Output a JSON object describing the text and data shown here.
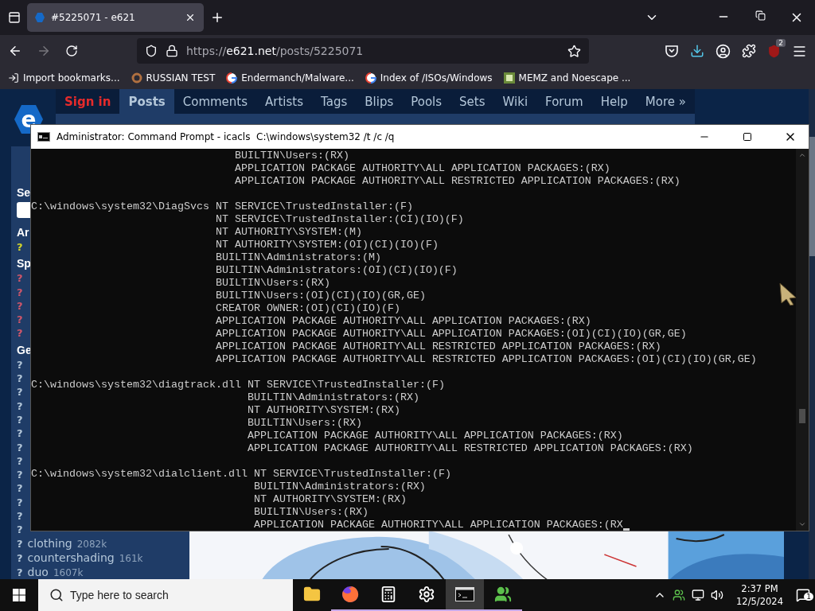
{
  "browser": {
    "tabs": [
      {
        "title": "#5225071 - e621",
        "selected": true
      }
    ],
    "url": {
      "scheme": "https://",
      "domain": "e621.net",
      "path": "/posts/5225071"
    },
    "extension_badge": "2",
    "bookmarks": [
      {
        "label": "Import bookmarks...",
        "kind": "import"
      },
      {
        "label": "RUSSIAN TEST",
        "kind": "avatar"
      },
      {
        "label": "Endermanch/Malware...",
        "kind": "google"
      },
      {
        "label": "Index of /ISOs/Windows",
        "kind": "google"
      },
      {
        "label": "MEMZ and Noescape ...",
        "kind": "site"
      }
    ]
  },
  "site": {
    "logo_text": "e",
    "nav": [
      {
        "label": "Sign in",
        "kind": "signin",
        "selected": false
      },
      {
        "label": "Posts",
        "kind": "link",
        "selected": true
      },
      {
        "label": "Comments",
        "kind": "link",
        "selected": false
      },
      {
        "label": "Artists",
        "kind": "link",
        "selected": false
      },
      {
        "label": "Tags",
        "kind": "link",
        "selected": false
      },
      {
        "label": "Blips",
        "kind": "link",
        "selected": false
      },
      {
        "label": "Pools",
        "kind": "link",
        "selected": false
      },
      {
        "label": "Sets",
        "kind": "link",
        "selected": false
      },
      {
        "label": "Wiki",
        "kind": "link",
        "selected": false
      },
      {
        "label": "Forum",
        "kind": "link",
        "selected": false
      },
      {
        "label": "Help",
        "kind": "link",
        "selected": false
      },
      {
        "label": "More »",
        "kind": "link",
        "selected": false
      }
    ],
    "sidebar": {
      "search_heading": "Se",
      "groups": [
        {
          "heading": "Ar",
          "color": "#d6d62a",
          "tags": [
            {
              "mark": "?"
            }
          ]
        },
        {
          "heading": "Sp",
          "color": "#d0566a",
          "tags": [
            {
              "mark": "?"
            },
            {
              "mark": "?"
            },
            {
              "mark": "?"
            },
            {
              "mark": "?"
            },
            {
              "mark": "?"
            }
          ]
        },
        {
          "heading": "Ge",
          "color": "#b4c7d9",
          "tags": [
            {
              "mark": "?"
            },
            {
              "mark": "?"
            },
            {
              "mark": "?"
            },
            {
              "mark": "?"
            },
            {
              "mark": "?"
            },
            {
              "mark": "?"
            },
            {
              "mark": "?"
            },
            {
              "mark": "?"
            },
            {
              "mark": "?"
            },
            {
              "mark": "?"
            },
            {
              "mark": "?"
            },
            {
              "mark": "?"
            },
            {
              "mark": "?"
            },
            {
              "mark": "?",
              "name": "clothing",
              "count": "2082k"
            },
            {
              "mark": "?",
              "name": "countershading",
              "count": "161k"
            },
            {
              "mark": "?",
              "name": "duo",
              "count": "1607k"
            }
          ]
        }
      ]
    }
  },
  "console": {
    "title": "Administrator: Command Prompt - icacls  C:\\windows\\system32 /t /c /q",
    "blocks": [
      {
        "entries": [
          "BUILTIN\\Users:(RX)",
          "APPLICATION PACKAGE AUTHORITY\\ALL APPLICATION PACKAGES:(RX)",
          "APPLICATION PACKAGE AUTHORITY\\ALL RESTRICTED APPLICATION PACKAGES:(RX)"
        ]
      },
      {
        "path": "C:\\windows\\system32\\DiagSvcs",
        "entries": [
          "NT SERVICE\\TrustedInstaller:(F)",
          "NT SERVICE\\TrustedInstaller:(CI)(IO)(F)",
          "NT AUTHORITY\\SYSTEM:(M)",
          "NT AUTHORITY\\SYSTEM:(OI)(CI)(IO)(F)",
          "BUILTIN\\Administrators:(M)",
          "BUILTIN\\Administrators:(OI)(CI)(IO)(F)",
          "BUILTIN\\Users:(RX)",
          "BUILTIN\\Users:(OI)(CI)(IO)(GR,GE)",
          "CREATOR OWNER:(OI)(CI)(IO)(F)",
          "APPLICATION PACKAGE AUTHORITY\\ALL APPLICATION PACKAGES:(RX)",
          "APPLICATION PACKAGE AUTHORITY\\ALL APPLICATION PACKAGES:(OI)(CI)(IO)(GR,GE)",
          "APPLICATION PACKAGE AUTHORITY\\ALL RESTRICTED APPLICATION PACKAGES:(RX)",
          "APPLICATION PACKAGE AUTHORITY\\ALL RESTRICTED APPLICATION PACKAGES:(OI)(CI)(IO)(GR,GE)"
        ]
      },
      {
        "path": "C:\\windows\\system32\\diagtrack.dll",
        "entries": [
          "NT SERVICE\\TrustedInstaller:(F)",
          "BUILTIN\\Administrators:(RX)",
          "NT AUTHORITY\\SYSTEM:(RX)",
          "BUILTIN\\Users:(RX)",
          "APPLICATION PACKAGE AUTHORITY\\ALL APPLICATION PACKAGES:(RX)",
          "APPLICATION PACKAGE AUTHORITY\\ALL RESTRICTED APPLICATION PACKAGES:(RX)"
        ]
      },
      {
        "path": "C:\\windows\\system32\\dialclient.dll",
        "entries": [
          "NT SERVICE\\TrustedInstaller:(F)",
          "BUILTIN\\Administrators:(RX)",
          "NT AUTHORITY\\SYSTEM:(RX)",
          "BUILTIN\\Users:(RX)",
          "APPLICATION PACKAGE AUTHORITY\\ALL APPLICATION PACKAGES:(RX"
        ]
      }
    ]
  },
  "taskbar": {
    "search_placeholder": "Type here to search",
    "apps": [
      {
        "kind": "explorer",
        "running": false,
        "selected": false
      },
      {
        "kind": "firefox",
        "running": true,
        "selected": false
      },
      {
        "kind": "calculator",
        "running": true,
        "selected": false
      },
      {
        "kind": "settings",
        "running": true,
        "selected": false
      },
      {
        "kind": "terminal",
        "running": true,
        "selected": true
      },
      {
        "kind": "people",
        "running": true,
        "selected": false
      }
    ],
    "time": "2:37 PM",
    "date": "12/5/2024",
    "notification_count": "1"
  }
}
